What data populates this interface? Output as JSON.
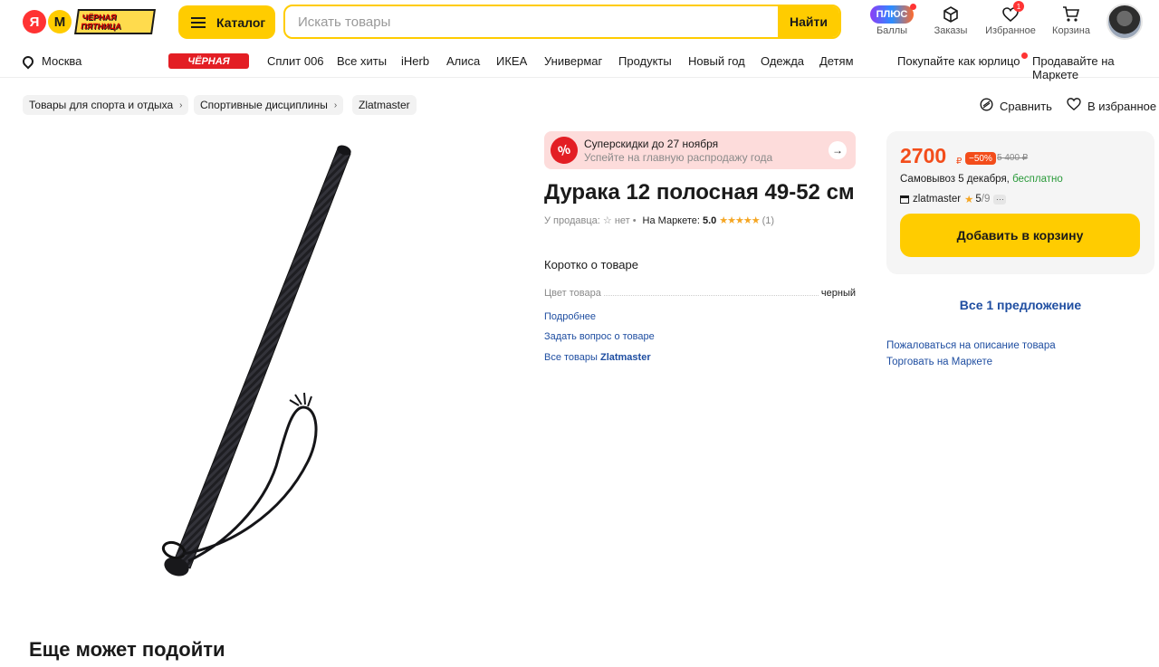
{
  "header": {
    "logo_ya": "Я",
    "logo_m": "М",
    "promo_line1": "ЧЁРНАЯ",
    "promo_line2": "ПЯТНИЦА",
    "catalog_label": "Каталог",
    "search_placeholder": "Искать товары",
    "search_button": "Найти",
    "plus_label": "ПЛЮС",
    "points_label": "Баллы",
    "orders_label": "Заказы",
    "favorites_label": "Избранное",
    "favorites_count": "1",
    "cart_label": "Корзина"
  },
  "nav": {
    "city": "Москва",
    "black_badge": "ЧЁРНАЯ",
    "items": [
      "Сплит 006",
      "Все хиты",
      "iHerb",
      "Алиса",
      "ИКЕА",
      "Универмаг",
      "Продукты",
      "Новый год",
      "Одежда",
      "Детям"
    ],
    "legal": "Покупайте как юрлицо",
    "sell": "Продавайте на Маркете"
  },
  "breadcrumbs": [
    "Товары для спорта и отдыха",
    "Спортивные дисциплины",
    "Zlatmaster"
  ],
  "actions": {
    "compare": "Сравнить",
    "favorite": "В избранное"
  },
  "sale_banner": {
    "icon": "%",
    "title": "Суперскидки до 27 ноября",
    "subtitle": "Успейте на главную распродажу года"
  },
  "product": {
    "title": "Дурака 12 полосная 49-52 см",
    "seller_rating_label": "У продавца: ☆ нет",
    "market_rating_label": "На Маркете:",
    "market_score": "5.0",
    "stars": "★★★★★",
    "reviews_count": "(1)",
    "short_heading": "Коротко о товаре",
    "spec_key": "Цвет товара",
    "spec_value": "черный",
    "link_more": "Подробнее",
    "link_ask": "Задать вопрос о товаре",
    "link_all_prefix": "Все товары",
    "link_all_brand": "Zlatmaster"
  },
  "offer": {
    "price": "2700",
    "currency": "₽",
    "discount": "−50%",
    "old_price": "5 400 ₽",
    "delivery_text": "Самовывоз 5 декабря,",
    "delivery_free": "бесплатно",
    "seller_name": "zlatmaster",
    "seller_score": "5",
    "seller_denom": "/9",
    "more": "···",
    "cart_button": "Добавить в корзину",
    "offers_link": "Все 1 предложение",
    "complain": "Пожаловаться на описание товара",
    "sell_on_market": "Торговать на Маркете"
  },
  "section_title": "Еще может подойти",
  "colors": {
    "accent_yellow": "#ffcc00",
    "price_orange": "#f34d1b",
    "link_blue": "#1f4ea1",
    "free_green": "#2a9a3a"
  }
}
